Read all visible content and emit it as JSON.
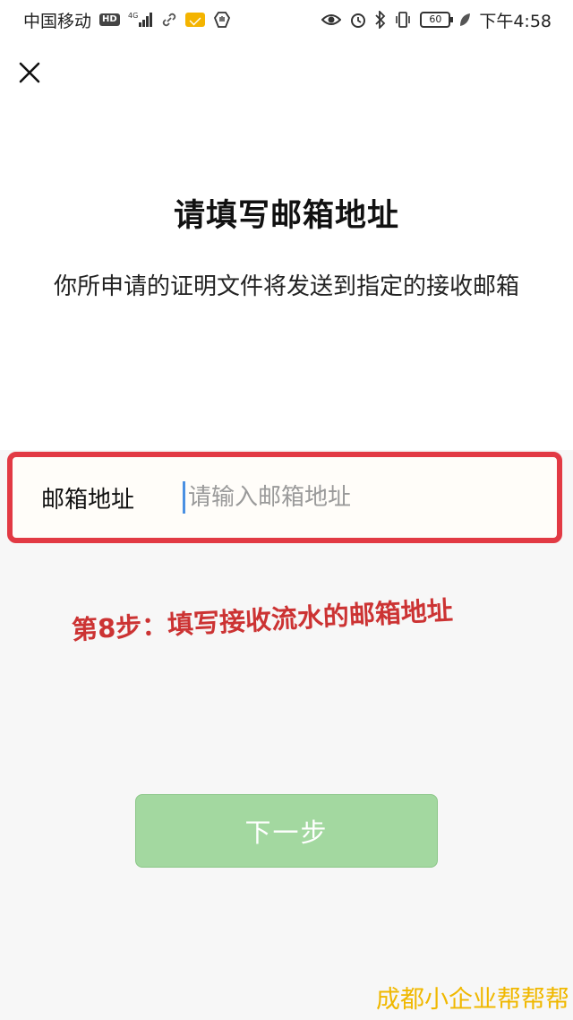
{
  "status_bar": {
    "carrier": "中国移动",
    "hd_label": "HD",
    "network": "4G",
    "battery": "60",
    "time": "下午4:58",
    "icons": [
      "hd-icon",
      "signal-icon",
      "link-icon",
      "mail-icon",
      "hand-icon",
      "eye-icon",
      "alarm-icon",
      "bluetooth-icon",
      "vibrate-icon",
      "battery-icon",
      "leaf-icon"
    ]
  },
  "header": {
    "close_icon": "close-icon"
  },
  "main": {
    "title": "请填写邮箱地址",
    "description": "你所申请的证明文件将发送到指定的接收邮箱"
  },
  "form": {
    "email_label": "邮箱地址",
    "email_placeholder": "请输入邮箱地址",
    "email_value": "",
    "highlight_color": "#e23a44"
  },
  "annotation": {
    "text": "第8步：填写接收流水的邮箱地址",
    "color": "#cc3333"
  },
  "next_button": {
    "label": "下一步",
    "color": "#a3d8a0",
    "disabled": true
  },
  "watermark": {
    "text": "成都小企业帮帮帮",
    "color": "#f0b800"
  }
}
